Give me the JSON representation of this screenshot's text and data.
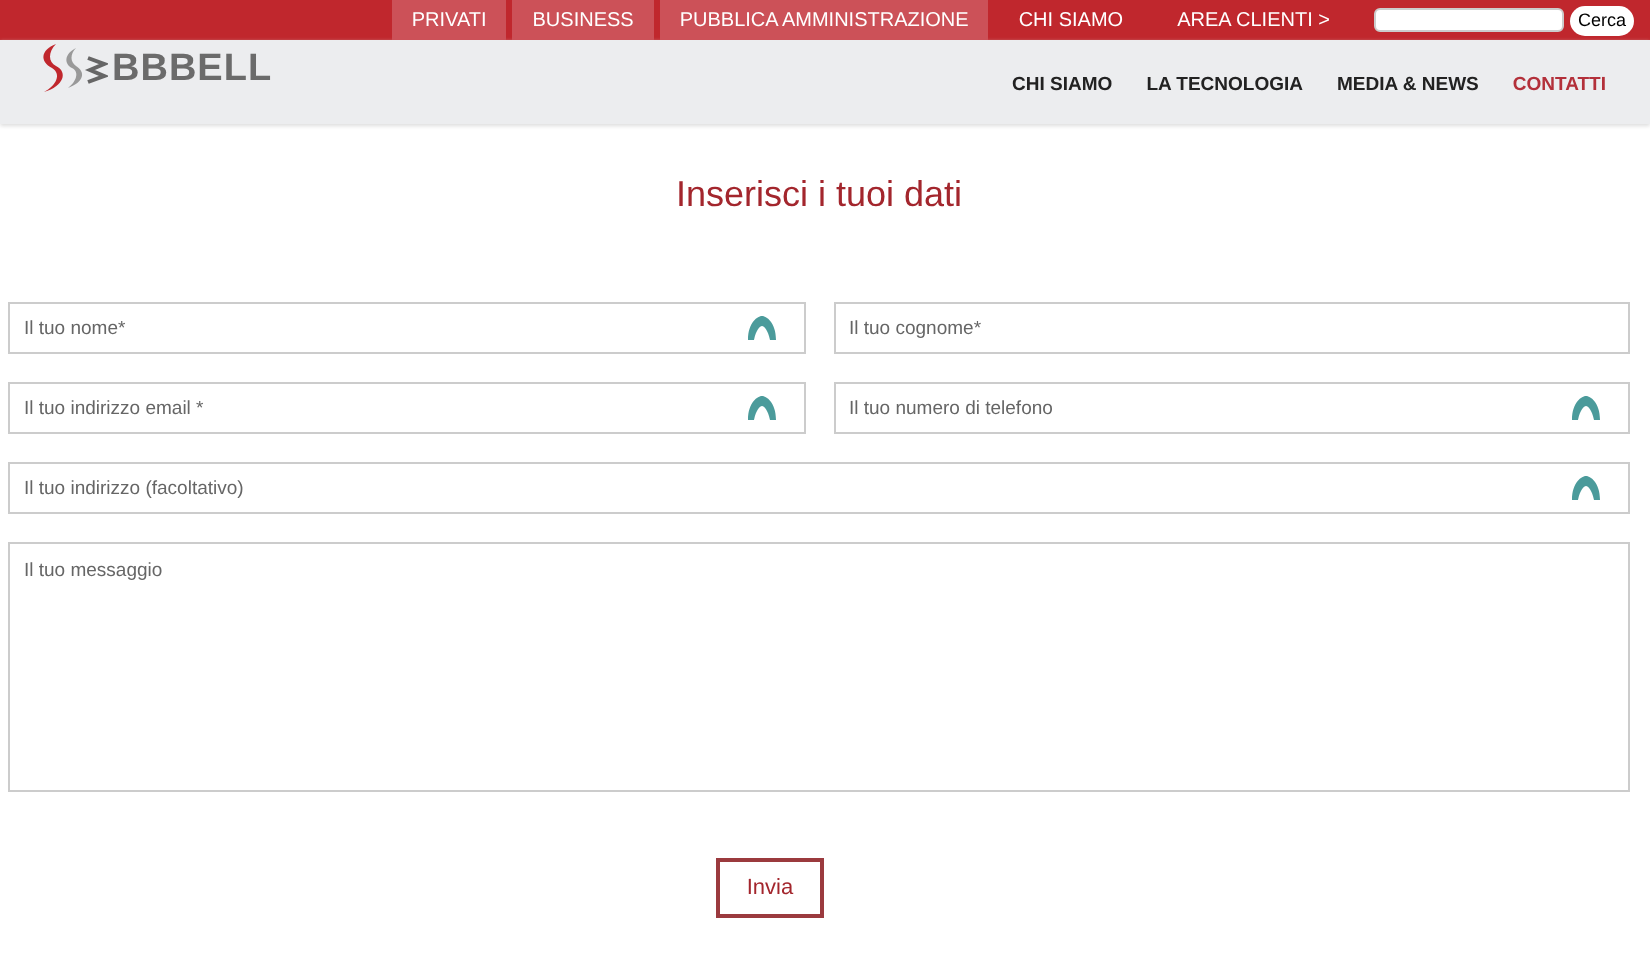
{
  "top_bar": {
    "links": [
      {
        "label": "PRIVATI",
        "shaded": true
      },
      {
        "label": "BUSINESS",
        "shaded": true
      },
      {
        "label": "PUBBLICA AMMINISTRAZIONE",
        "shaded": true
      },
      {
        "label": "CHI SIAMO",
        "shaded": false
      },
      {
        "label": "AREA CLIENTI >",
        "shaded": false
      }
    ],
    "search_button": "Cerca"
  },
  "header": {
    "logo": "BBBELL",
    "nav": [
      {
        "label": "CHI SIAMO",
        "selected": false
      },
      {
        "label": "LA TECNOLOGIA",
        "selected": false
      },
      {
        "label": "MEDIA & NEWS",
        "selected": false
      },
      {
        "label": "CONTATTI",
        "selected": true
      }
    ]
  },
  "form": {
    "title": "Inserisci i tuoi dati",
    "fields": [
      {
        "kind": "half",
        "placeholder": "Il tuo nome*",
        "icon": true
      },
      {
        "kind": "half",
        "placeholder": "Il tuo cognome*",
        "icon": false
      },
      {
        "kind": "half",
        "placeholder": "Il tuo indirizzo email *",
        "icon": true
      },
      {
        "kind": "half",
        "placeholder": "Il tuo numero di telefono",
        "icon": true
      },
      {
        "kind": "full",
        "placeholder": "Il tuo indirizzo (facoltativo)",
        "icon": true
      },
      {
        "kind": "area",
        "placeholder": "Il tuo messaggio",
        "icon": false
      }
    ],
    "submit": "Invia"
  }
}
